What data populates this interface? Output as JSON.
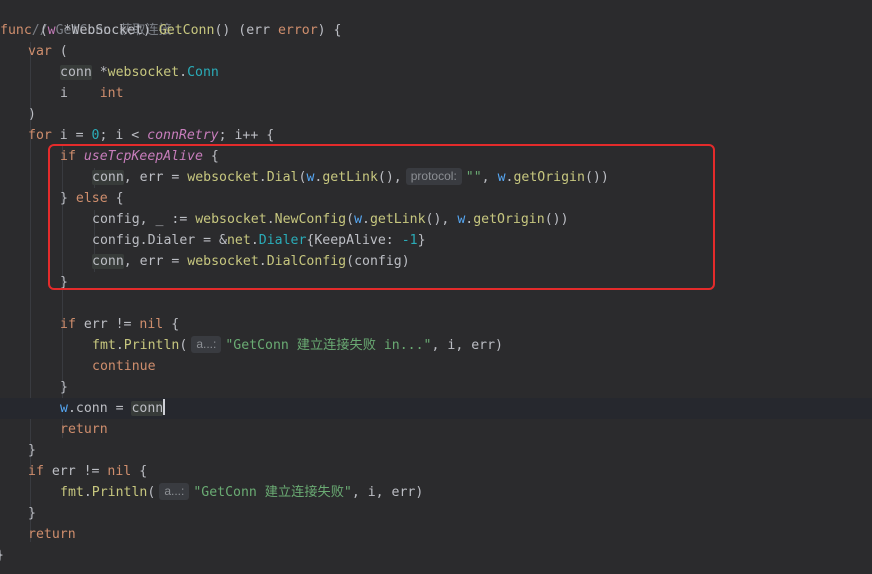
{
  "editor": {
    "comment": "// GetConn 获取连接",
    "lines": {
      "l1": {
        "kw": "func",
        "recv_open": " (",
        "recv_name": "w",
        "recv_star": " *",
        "recv_type": "WebSocket",
        "recv_close": ") ",
        "fn": "GetConn",
        "rest1": "() (err ",
        "err_type": "error",
        "rest2": ") {"
      },
      "l2": {
        "kw": "var",
        "rest": " ("
      },
      "l3": {
        "name": "conn",
        "star": " *",
        "pkg": "websocket",
        "dot": ".",
        "type": "Conn"
      },
      "l4": {
        "name": "i",
        "space": "    ",
        "type": "int"
      },
      "l5": {
        "text": ")"
      },
      "l6": {
        "kw": "for",
        "a": " i = ",
        "num": "0",
        "b": "; i < ",
        "glob": "connRetry",
        "c": "; i++ {"
      },
      "l7": {
        "kw": "if",
        "sp": " ",
        "glob": "useTcpKeepAlive",
        "rest": " {"
      },
      "l8": {
        "conn": "conn",
        "a": ", err = ",
        "pkg": "websocket",
        "dot": ".",
        "fn": "Dial",
        "p1": "(",
        "w": "w",
        "d2": ".",
        "m1": "getLink",
        "p2": "(),",
        "hint": "protocol:",
        "str": "\"\"",
        "p3": ", ",
        "w2": "w",
        "d3": ".",
        "m2": "getOrigin",
        "p4": "())"
      },
      "l9": {
        "a": "} ",
        "kw": "else",
        "b": " {"
      },
      "l10": {
        "a": "config, _ := ",
        "pkg": "websocket",
        "dot": ".",
        "fn": "NewConfig",
        "p1": "(",
        "w": "w",
        "d2": ".",
        "m1": "getLink",
        "p2": "(), ",
        "w2": "w",
        "d3": ".",
        "m2": "getOrigin",
        "p3": "())"
      },
      "l11": {
        "a": "config.Dialer = &",
        "pkg": "net",
        "dot": ".",
        "type": "Dialer",
        "b": "{KeepAlive: ",
        "num": "-1",
        "c": "}"
      },
      "l12": {
        "conn": "conn",
        "a": ", err = ",
        "pkg": "websocket",
        "dot": ".",
        "fn": "DialConfig",
        "b": "(config)"
      },
      "l13": {
        "text": "}"
      },
      "l15": {
        "kw": "if",
        "a": " err != ",
        "nil": "nil",
        "b": " {"
      },
      "l16": {
        "pkg": "fmt",
        "dot": ".",
        "fn": "Println",
        "p": "(",
        "hint": "a...:",
        "str": "\"GetConn 建立连接失败 in...\"",
        "rest": ", i, err)"
      },
      "l17": {
        "kw": "continue"
      },
      "l18": {
        "text": "}"
      },
      "l19": {
        "w": "w",
        "a": ".conn = ",
        "conn": "conn"
      },
      "l20": {
        "kw": "return"
      },
      "l21": {
        "text": "}"
      },
      "l22": {
        "kw": "if",
        "a": " err != ",
        "nil": "nil",
        "b": " {"
      },
      "l23": {
        "pkg": "fmt",
        "dot": ".",
        "fn": "Println",
        "p": "(",
        "hint": "a...:",
        "str": "\"GetConn 建立连接失败\"",
        "rest": ", i, err)"
      },
      "l24": {
        "text": "}"
      },
      "l25": {
        "kw": "return"
      },
      "l26": {
        "text": "}"
      }
    }
  },
  "colors": {
    "background": "#2b2b2d",
    "keyword": "#cf8e6d",
    "function": "#56a8f5",
    "string": "#6aab73",
    "highlight_box": "#e42b2b"
  }
}
